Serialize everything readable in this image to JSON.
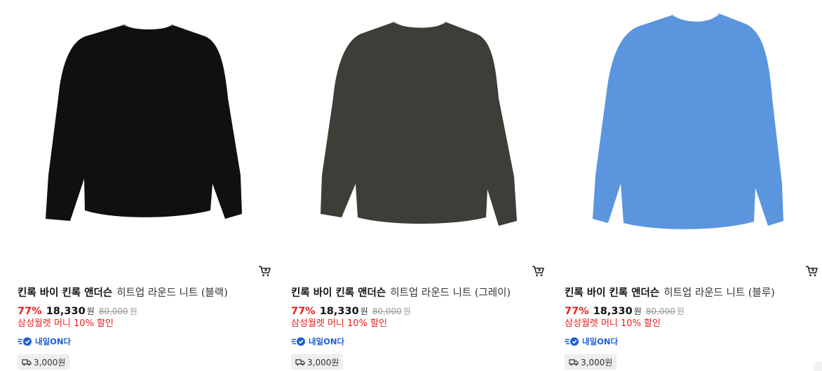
{
  "products": [
    {
      "brand": "킨록 바이 킨록 앤더슨",
      "name": "히트업 라운드 니트 (블랙)",
      "discount": "77%",
      "price": "18,330",
      "price_unit": "원",
      "original_price": "80,000",
      "original_unit": "원",
      "benefit": "삼성월렛 머니 10% 할인",
      "delivery_badge": "내일ON다",
      "shipping_fee": "3,000원",
      "sweater_color": "#101010",
      "icons": {
        "cart": "cart-icon",
        "delivery": "rocket-delivery-icon",
        "truck": "truck-icon"
      }
    },
    {
      "brand": "킨록 바이 킨록 앤더슨",
      "name": "히트업 라운드 니트 (그레이)",
      "discount": "77%",
      "price": "18,330",
      "price_unit": "원",
      "original_price": "80,000",
      "original_unit": "원",
      "benefit": "삼성월렛 머니 10% 할인",
      "delivery_badge": "내일ON다",
      "shipping_fee": "3,000원",
      "sweater_color": "#3e3e38",
      "icons": {
        "cart": "cart-icon",
        "delivery": "rocket-delivery-icon",
        "truck": "truck-icon"
      }
    },
    {
      "brand": "킨록 바이 킨록 앤더슨",
      "name": "히트업 라운드 니트 (블루)",
      "discount": "77%",
      "price": "18,330",
      "price_unit": "원",
      "original_price": "80,000",
      "original_unit": "원",
      "benefit": "삼성월렛 머니 10% 할인",
      "delivery_badge": "내일ON다",
      "shipping_fee": "3,000원",
      "sweater_color": "#5b95de",
      "icons": {
        "cart": "cart-icon",
        "delivery": "rocket-delivery-icon",
        "truck": "truck-icon"
      }
    }
  ],
  "colors": {
    "discount": "#e4201f",
    "benefit": "#e4201f",
    "delivery_badge": "#1f5fd6",
    "shipping_bg": "#eeeeee"
  }
}
